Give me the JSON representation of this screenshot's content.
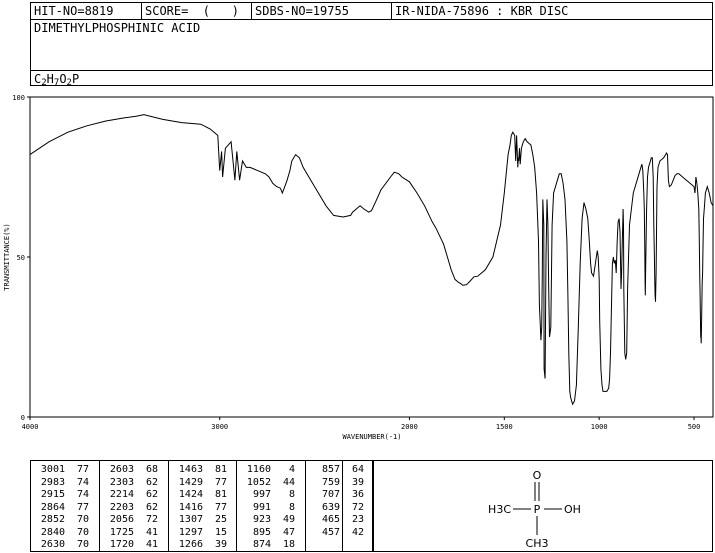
{
  "header": {
    "hit_no": "HIT-NO=8819",
    "score": "SCORE=  (   )",
    "sdbs_no": "SDBS-NO=19755",
    "ir_nida": "IR-NIDA-75896 : KBR DISC",
    "compound_name": "DIMETHYLPHOSPHINIC ACID",
    "formula_parts": [
      "C",
      "2",
      "H",
      "7",
      "O",
      "2",
      "P"
    ]
  },
  "chart_data": {
    "type": "line",
    "title": "",
    "xlabel": "WAVENUMBER(-1)",
    "ylabel": "TRANSMITTANCE(%)",
    "xlim": [
      4000,
      400
    ],
    "ylim": [
      0,
      100
    ],
    "x_reversed": true,
    "x_ticks": [
      4000,
      3000,
      2000,
      1500,
      1000,
      500
    ],
    "x_tick_labels": [
      "4000",
      "3000",
      "2000",
      "1500",
      "1000",
      "500"
    ],
    "y_ticks": [
      0,
      50,
      100
    ],
    "y_tick_labels": [
      "0",
      "50",
      "100"
    ],
    "grid": false,
    "legend": "none",
    "line_color": "#000000",
    "series": [
      {
        "x": [
          4000,
          3900,
          3800,
          3700,
          3600,
          3500,
          3440,
          3400,
          3300,
          3200,
          3100,
          3050,
          3010,
          3000,
          2990,
          2985,
          2970,
          2940,
          2920,
          2910,
          2895,
          2880,
          2860,
          2840,
          2800,
          2760,
          2740,
          2720,
          2700,
          2680,
          2670,
          2660,
          2645,
          2630,
          2620,
          2600,
          2580,
          2560,
          2520,
          2480,
          2440,
          2400,
          2350,
          2310,
          2300,
          2280,
          2260,
          2240,
          2214,
          2200,
          2180,
          2150,
          2100,
          2080,
          2056,
          2040,
          2000,
          1960,
          1920,
          1880,
          1860,
          1820,
          1800,
          1780,
          1760,
          1740,
          1725,
          1720,
          1700,
          1680,
          1660,
          1640,
          1620,
          1600,
          1560,
          1540,
          1520,
          1500,
          1480,
          1470,
          1463,
          1455,
          1445,
          1440,
          1435,
          1429,
          1426,
          1424,
          1420,
          1416,
          1410,
          1400,
          1390,
          1380,
          1360,
          1350,
          1340,
          1330,
          1320,
          1315,
          1310,
          1307,
          1303,
          1300,
          1297,
          1292,
          1290,
          1285,
          1280,
          1275,
          1270,
          1266,
          1262,
          1255,
          1248,
          1240,
          1220,
          1210,
          1200,
          1190,
          1180,
          1170,
          1165,
          1160,
          1155,
          1150,
          1140,
          1130,
          1120,
          1110,
          1100,
          1090,
          1080,
          1070,
          1060,
          1052,
          1045,
          1040,
          1030,
          1020,
          1010,
          1005,
          1000,
          997,
          991,
          985,
          980,
          970,
          960,
          950,
          945,
          940,
          935,
          930,
          925,
          923,
          920,
          915,
          910,
          905,
          900,
          895,
          890,
          885,
          882,
          878,
          875,
          874,
          872,
          870,
          865,
          860,
          855,
          850,
          840,
          820,
          800,
          790,
          780,
          775,
          770,
          765,
          762,
          760,
          758,
          757,
          755,
          750,
          745,
          740,
          730,
          725,
          720,
          715,
          712,
          709,
          707,
          705,
          703,
          700,
          695,
          690,
          680,
          670,
          660,
          650,
          645,
          640,
          639,
          635,
          630,
          620,
          610,
          600,
          590,
          580,
          570,
          560,
          550,
          540,
          530,
          520,
          510,
          500,
          495,
          490,
          485,
          480,
          475,
          472,
          470,
          468,
          465,
          463,
          462,
          460,
          458,
          457,
          455,
          452,
          450,
          445,
          440,
          430,
          420,
          410,
          400
        ],
        "y": [
          82,
          86,
          89,
          91,
          92.5,
          93.5,
          94,
          94.5,
          93,
          92,
          91.5,
          90,
          88,
          77,
          83,
          75,
          84,
          86,
          74,
          83,
          74,
          80,
          78,
          78,
          77,
          76,
          75,
          73,
          72,
          71.5,
          70,
          71.5,
          74,
          77,
          80,
          82,
          81,
          78,
          74,
          70,
          66,
          63,
          62.5,
          63,
          64,
          65,
          66,
          65,
          64,
          64.5,
          67,
          71,
          75,
          76.5,
          76,
          75,
          73.5,
          70,
          66,
          61,
          59,
          54,
          50,
          46,
          43,
          42,
          41.5,
          41.2,
          41.3,
          42.5,
          43.8,
          44,
          45,
          46,
          50,
          55,
          60,
          70,
          82,
          85,
          88,
          89,
          88,
          80,
          88,
          78,
          81,
          80,
          84,
          79,
          84,
          86,
          87,
          86,
          85,
          82,
          78,
          70,
          55,
          35,
          28,
          24,
          28,
          45,
          68,
          60,
          15,
          12,
          50,
          68,
          60,
          40,
          25,
          28,
          60,
          70,
          74,
          76,
          76,
          73,
          68,
          55,
          38,
          20,
          8,
          6,
          4,
          5,
          10,
          28,
          48,
          62,
          67,
          65,
          62,
          55,
          48,
          45,
          44,
          48,
          52,
          50,
          43,
          30,
          15,
          10,
          8,
          8,
          8,
          9,
          12,
          20,
          35,
          48,
          50,
          49,
          48,
          49,
          45,
          55,
          61,
          62,
          58,
          40,
          45,
          55,
          62,
          65,
          60,
          40,
          20,
          18,
          20,
          40,
          60,
          70,
          74,
          76,
          78,
          79,
          77,
          70,
          65,
          55,
          42,
          38,
          45,
          65,
          75,
          78,
          80,
          81,
          81,
          75,
          60,
          50,
          42,
          38,
          36,
          45,
          72,
          78,
          80,
          80.5,
          81,
          82,
          82.5,
          82,
          80,
          74,
          72,
          72.5,
          74,
          75.5,
          76,
          76,
          75.5,
          75,
          74.5,
          74,
          73.5,
          73,
          72.5,
          72,
          70,
          75,
          73,
          70,
          65,
          55,
          45,
          38,
          25,
          25,
          23,
          30,
          38,
          42,
          45,
          55,
          62,
          66,
          70,
          72,
          70,
          67,
          66
        ]
      }
    ]
  },
  "peak_table": {
    "columns": [
      [
        [
          "3001",
          "77"
        ],
        [
          "2983",
          "74"
        ],
        [
          "2915",
          "74"
        ],
        [
          "2864",
          "77"
        ],
        [
          "2852",
          "70"
        ],
        [
          "2840",
          "70"
        ],
        [
          "2630",
          "70"
        ]
      ],
      [
        [
          "2603",
          "68"
        ],
        [
          "2303",
          "62"
        ],
        [
          "2214",
          "62"
        ],
        [
          "2203",
          "62"
        ],
        [
          "2056",
          "72"
        ],
        [
          "1725",
          "41"
        ],
        [
          "1720",
          "41"
        ]
      ],
      [
        [
          "1463",
          "81"
        ],
        [
          "1429",
          "77"
        ],
        [
          "1424",
          "81"
        ],
        [
          "1416",
          "77"
        ],
        [
          "1307",
          "25"
        ],
        [
          "1297",
          "15"
        ],
        [
          "1266",
          "39"
        ]
      ],
      [
        [
          "1160",
          "4"
        ],
        [
          "1052",
          "44"
        ],
        [
          "997",
          "8"
        ],
        [
          "991",
          "8"
        ],
        [
          "923",
          "49"
        ],
        [
          "895",
          "47"
        ],
        [
          "874",
          "18"
        ]
      ],
      [
        [
          "857",
          "64"
        ],
        [
          "759",
          "39"
        ],
        [
          "707",
          "36"
        ],
        [
          "639",
          "72"
        ],
        [
          "465",
          "23"
        ],
        [
          "457",
          "42"
        ]
      ],
      []
    ]
  },
  "structure": {
    "atoms": [
      "O",
      "H3C",
      "P",
      "OH",
      "CH3"
    ]
  }
}
